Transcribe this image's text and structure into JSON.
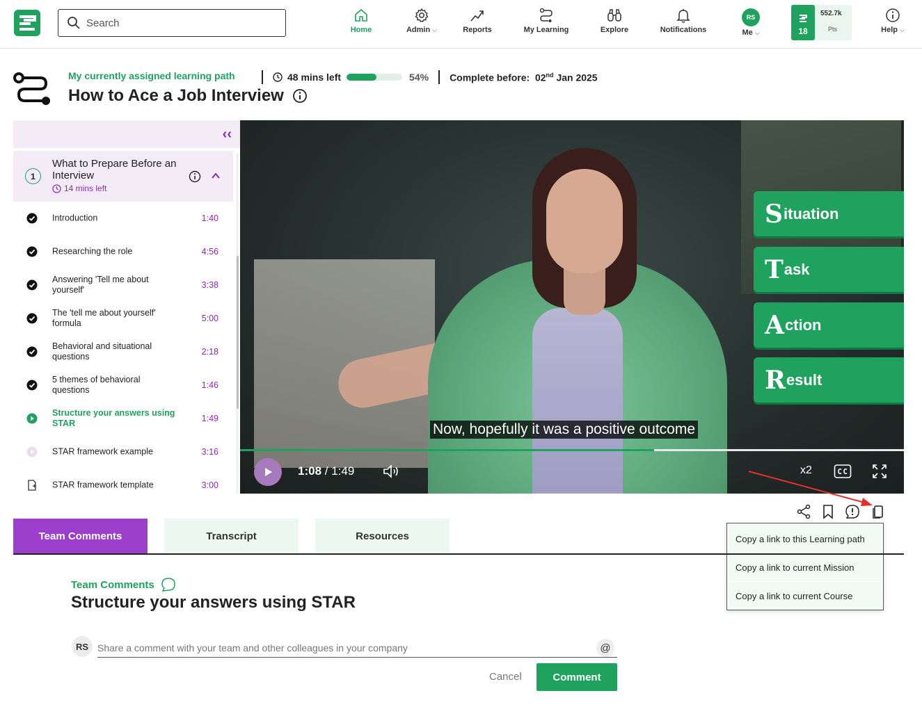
{
  "colors": {
    "brand_green": "#1fa25e",
    "accent_purple": "#9b3fcc",
    "text": "#222222"
  },
  "nav": {
    "search_placeholder": "Search",
    "items": [
      {
        "label": "Home",
        "icon": "home-icon",
        "active": true
      },
      {
        "label": "Admin",
        "icon": "gear-icon"
      },
      {
        "label": "Reports",
        "icon": "trend-icon"
      },
      {
        "label": "My Learning",
        "icon": "path-icon"
      },
      {
        "label": "Explore",
        "icon": "binoculars-icon"
      },
      {
        "label": "Notifications",
        "icon": "bell-icon"
      },
      {
        "label": "Me",
        "icon": "avatar"
      },
      {
        "label": "Help",
        "icon": "info-icon"
      }
    ],
    "avatar_initials": "RS",
    "points": {
      "level": "18",
      "value": "552.7k",
      "label": "Pts"
    }
  },
  "header": {
    "assigned_label": "My currently assigned learning path",
    "time_left": "48 mins left",
    "progress_percent": 54,
    "progress_label": "54%",
    "complete_before_label": "Complete before:",
    "due_day": "02",
    "due_suffix": "nd",
    "due_rest": "Jan 2025",
    "title": "How to Ace a Job Interview"
  },
  "sidebar": {
    "collapse_icon": "double-chevron-left-icon",
    "section": {
      "number": "1",
      "title": "What to Prepare Before an Interview",
      "time_left": "14 mins left"
    },
    "lessons": [
      {
        "name": "Introduction",
        "duration": "1:40",
        "status": "done"
      },
      {
        "name": "Researching the role",
        "duration": "4:56",
        "status": "done"
      },
      {
        "name": "Answering 'Tell me about yourself'",
        "duration": "3:38",
        "status": "done"
      },
      {
        "name": "The 'tell me about yourself' formula",
        "duration": "5:00",
        "status": "done"
      },
      {
        "name": "Behavioral and situational questions",
        "duration": "2:18",
        "status": "done"
      },
      {
        "name": "5 themes of behavioral questions",
        "duration": "1:46",
        "status": "done"
      },
      {
        "name": "Structure your answers using STAR",
        "duration": "1:49",
        "status": "current"
      },
      {
        "name": "STAR framework example",
        "duration": "3:16",
        "status": "pending"
      },
      {
        "name": "STAR framework template",
        "duration": "3:00",
        "status": "document"
      }
    ]
  },
  "video": {
    "star": [
      {
        "letter": "S",
        "rest": "ituation"
      },
      {
        "letter": "T",
        "rest": "ask"
      },
      {
        "letter": "A",
        "rest": "ction"
      },
      {
        "letter": "R",
        "rest": "esult"
      }
    ],
    "caption": "Now, hopefully it was a positive outcome",
    "current_time": "1:08",
    "separator": " / ",
    "total_time": "1:49",
    "progress_fraction": 0.624,
    "speed": "x2"
  },
  "actions": [
    "share-icon",
    "bookmark-icon",
    "report-icon",
    "copy-icon"
  ],
  "copy_menu": [
    "Copy a link to this Learning path",
    "Copy a link to current Mission",
    "Copy a link to current Course"
  ],
  "tabs": [
    {
      "label": "Team Comments",
      "active": true
    },
    {
      "label": "Transcript",
      "active": false
    },
    {
      "label": "Resources",
      "active": false
    }
  ],
  "comments": {
    "section_label": "Team Comments",
    "title": "Structure your answers using STAR",
    "avatar_initials": "RS",
    "placeholder": "Share a comment with your team and other colleagues in your company",
    "at_symbol": "@",
    "cancel_label": "Cancel",
    "submit_label": "Comment"
  }
}
